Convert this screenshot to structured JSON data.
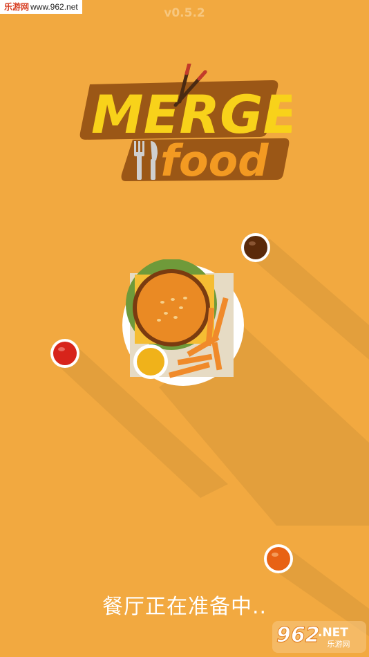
{
  "watermark": {
    "site_prefix": "乐游网",
    "site_url": "www.962.net"
  },
  "version": "v0.5.2",
  "logo": {
    "line1": "MERGE",
    "line2": "food"
  },
  "loading_text": "餐厅正在准备中..",
  "watermark_bottom": {
    "brand": "962",
    "suffix": ".NET",
    "sub": "乐游网"
  },
  "sauces": [
    {
      "name": "chocolate",
      "color": "#5b2a0a"
    },
    {
      "name": "ketchup",
      "color": "#d7241b"
    },
    {
      "name": "orange",
      "color": "#e86214"
    }
  ],
  "colors": {
    "background": "#f2a940",
    "logo_yellow": "#f8d21a",
    "logo_brown": "#9b5716",
    "logo_orange": "#f39a22"
  }
}
